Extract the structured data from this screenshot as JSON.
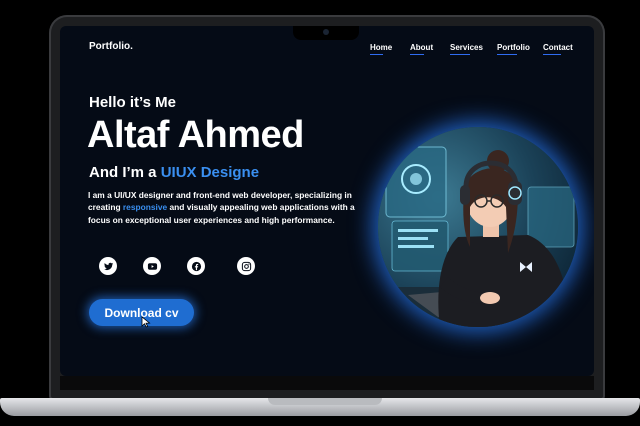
{
  "nav": {
    "logo": "Portfolio.",
    "items": [
      "Home",
      "About",
      "Services",
      "Portfolio",
      "Contact"
    ]
  },
  "hero": {
    "greeting": "Hello it’s Me",
    "name": "Altaf Ahmed",
    "role_prefix": "And I’m a ",
    "role_accent": "UIUX Designe",
    "desc_part1": "I am a UI/UX designer and front-end web developer, specializing in creating ",
    "desc_highlight": "responsive",
    "desc_part2": " and visually appealing web applications with a focus on exceptional user experiences and high performance.",
    "cv_button": "Download cv"
  },
  "social": [
    "twitter-icon",
    "youtube-icon",
    "facebook-icon",
    "instagram-icon"
  ],
  "colors": {
    "accent": "#3a8ff0",
    "button": "#1f6dd1",
    "background": "#050b16"
  }
}
